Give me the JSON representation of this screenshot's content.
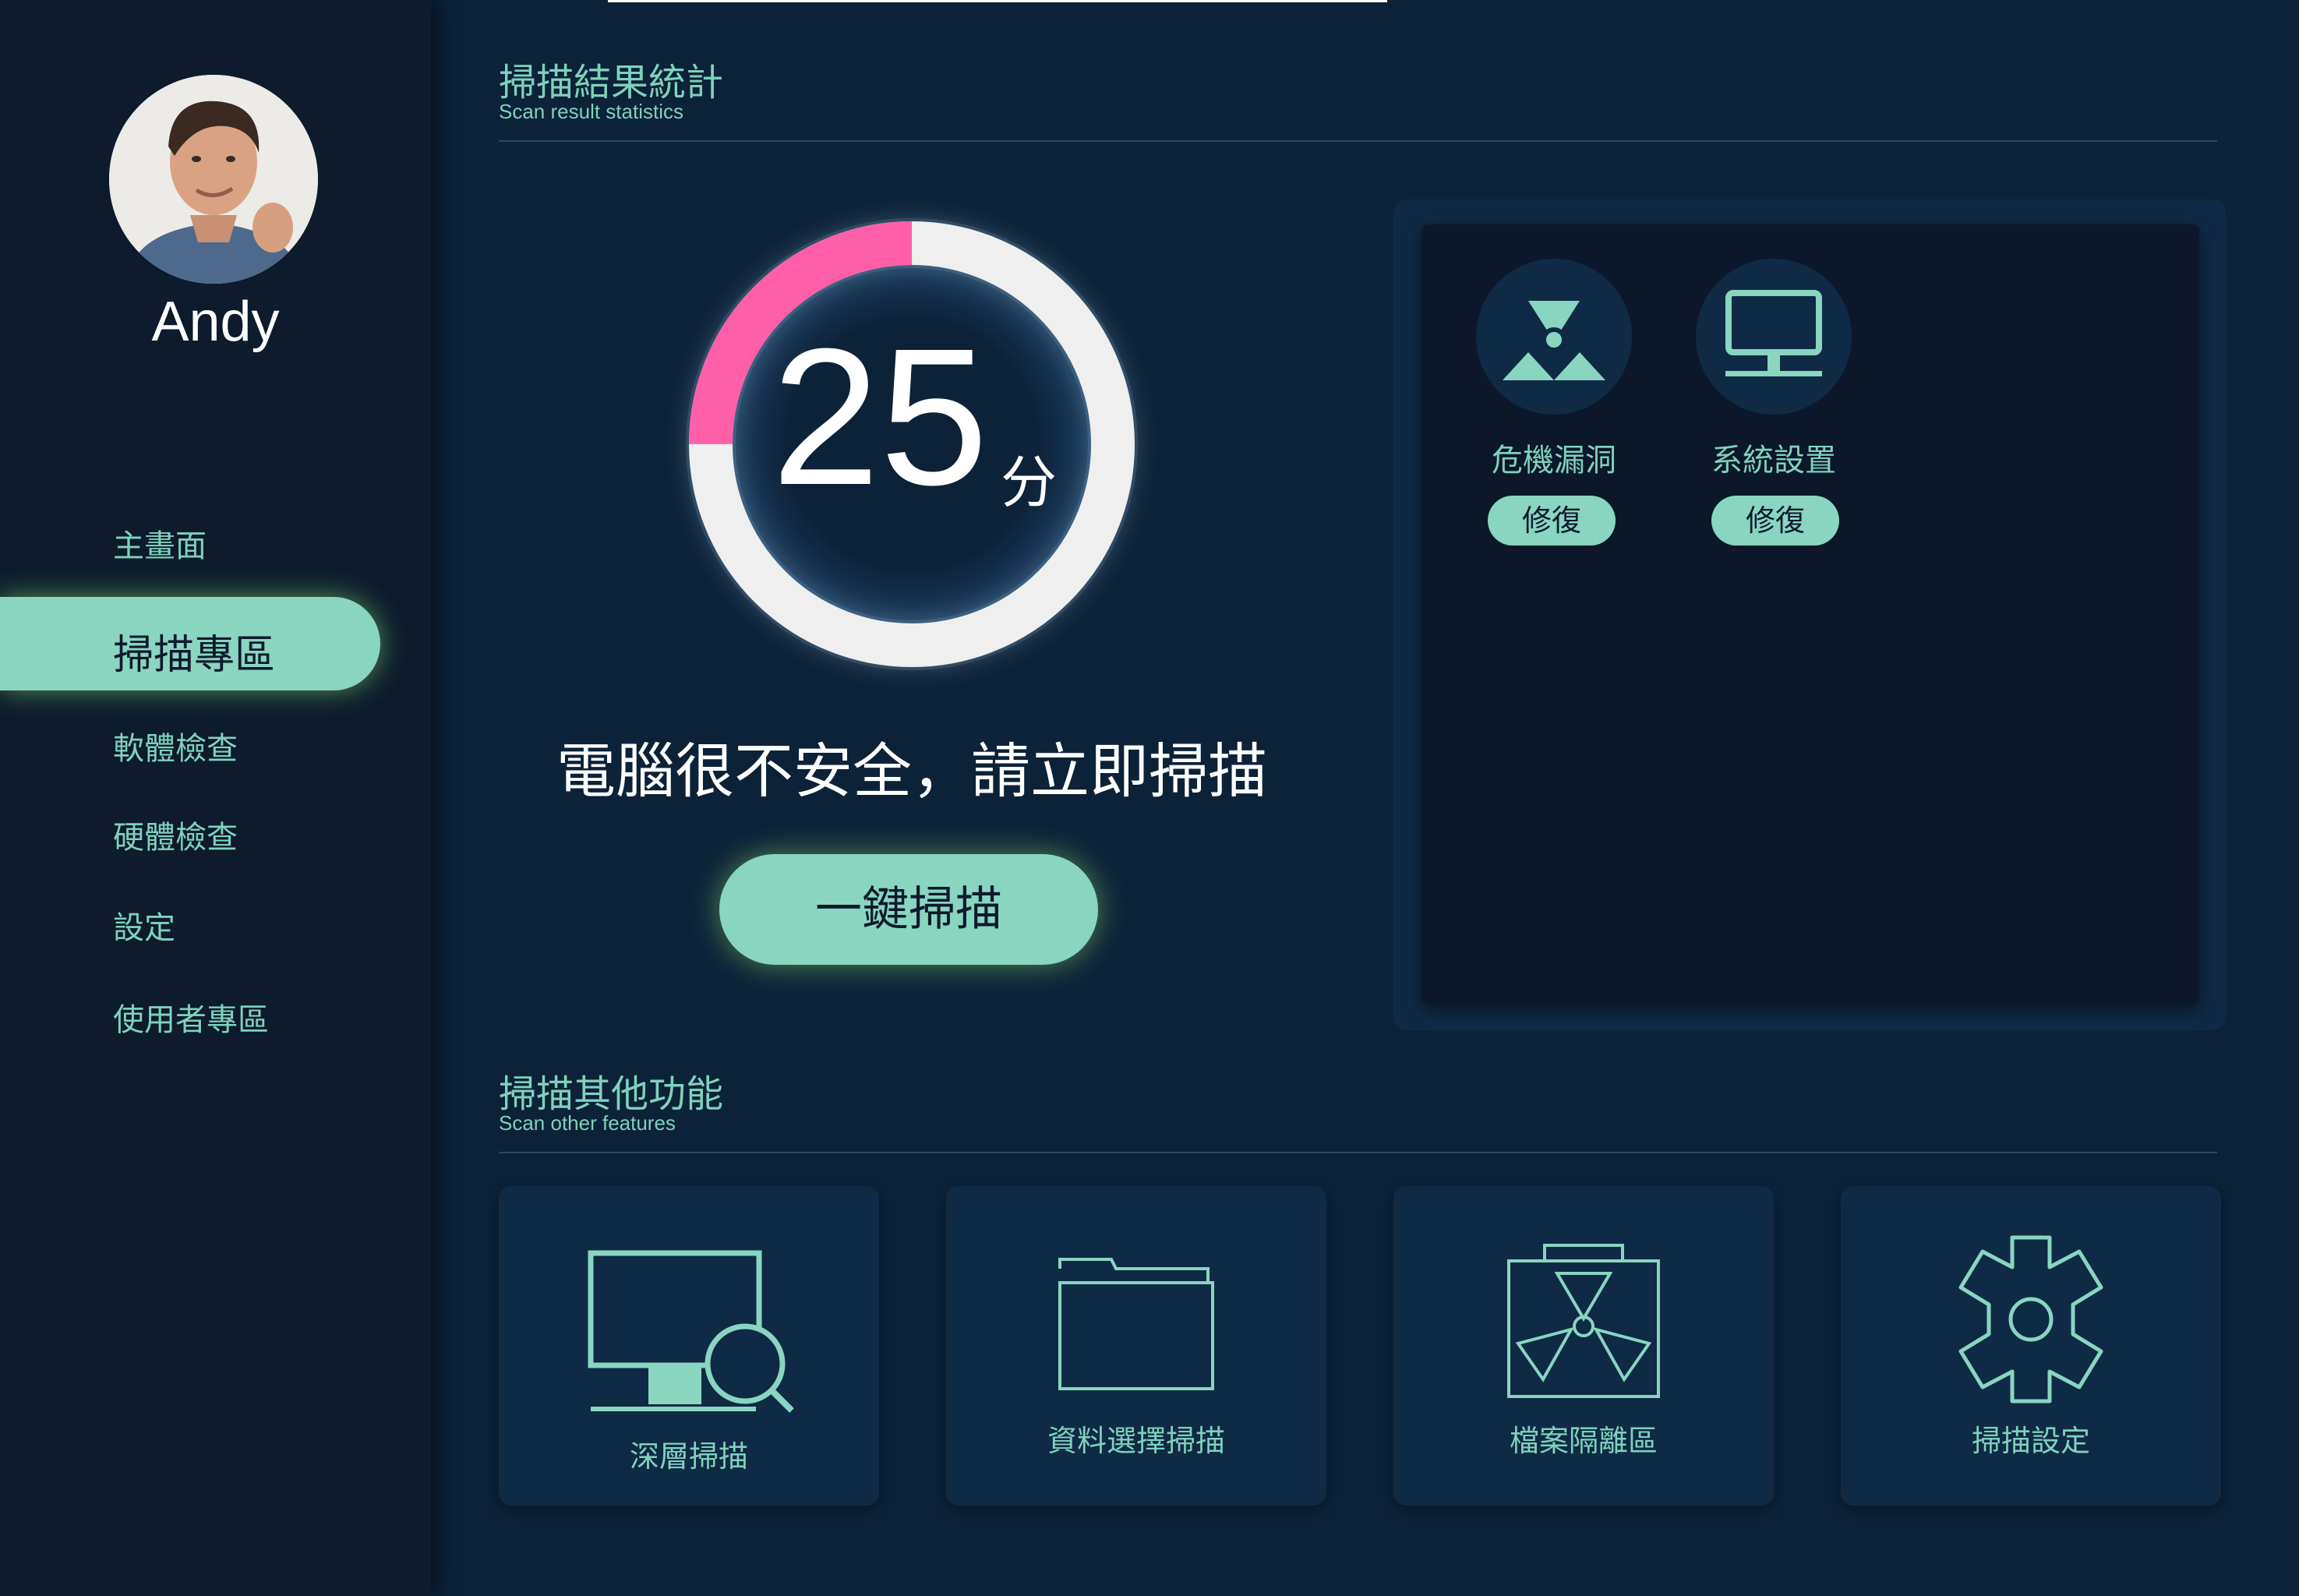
{
  "user": {
    "name": "Andy"
  },
  "sidebar": {
    "items": [
      {
        "label": "主畫面"
      },
      {
        "label": "掃描專區",
        "active": true
      },
      {
        "label": "軟體檢查"
      },
      {
        "label": "硬體檢查"
      },
      {
        "label": "設定"
      },
      {
        "label": "使用者專區"
      }
    ]
  },
  "scan_result": {
    "title": "掃描結果統計",
    "subtitle": "Scan result statistics",
    "score": "25",
    "score_unit": "分",
    "score_fraction": 0.25,
    "status_text": "電腦很不安全，請立即掃描",
    "scan_button_label": "一鍵掃描",
    "issues": [
      {
        "label": "危機漏洞",
        "icon": "radiation-icon",
        "fix_label": "修復"
      },
      {
        "label": "系統設置",
        "icon": "monitor-icon",
        "fix_label": "修復"
      }
    ]
  },
  "other_features": {
    "title": "掃描其他功能",
    "subtitle": "Scan other features",
    "cards": [
      {
        "label": "深層掃描",
        "icon": "monitor-search-icon"
      },
      {
        "label": "資料選擇掃描",
        "icon": "folder-icon"
      },
      {
        "label": "檔案隔離區",
        "icon": "quarantine-icon"
      },
      {
        "label": "掃描設定",
        "icon": "gear-icon"
      }
    ]
  },
  "colors": {
    "accent": "#89d5c0",
    "gauge_alert": "#ff5fa8",
    "background": "#0c2238",
    "sidebar": "#0d1b2c"
  }
}
